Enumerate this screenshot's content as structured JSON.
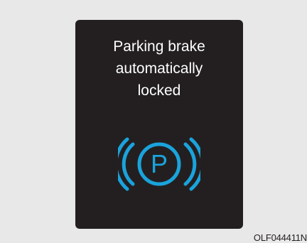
{
  "warning_popup": {
    "message_lines": [
      "Parking brake",
      "automatically",
      "locked"
    ],
    "icon": "parking-brake-icon",
    "icon_letter": "P",
    "icon_color": "#1aa3dc",
    "panel_color": "#231f20",
    "text_color": "#ffffff"
  },
  "figure_code": "OLF044411N"
}
